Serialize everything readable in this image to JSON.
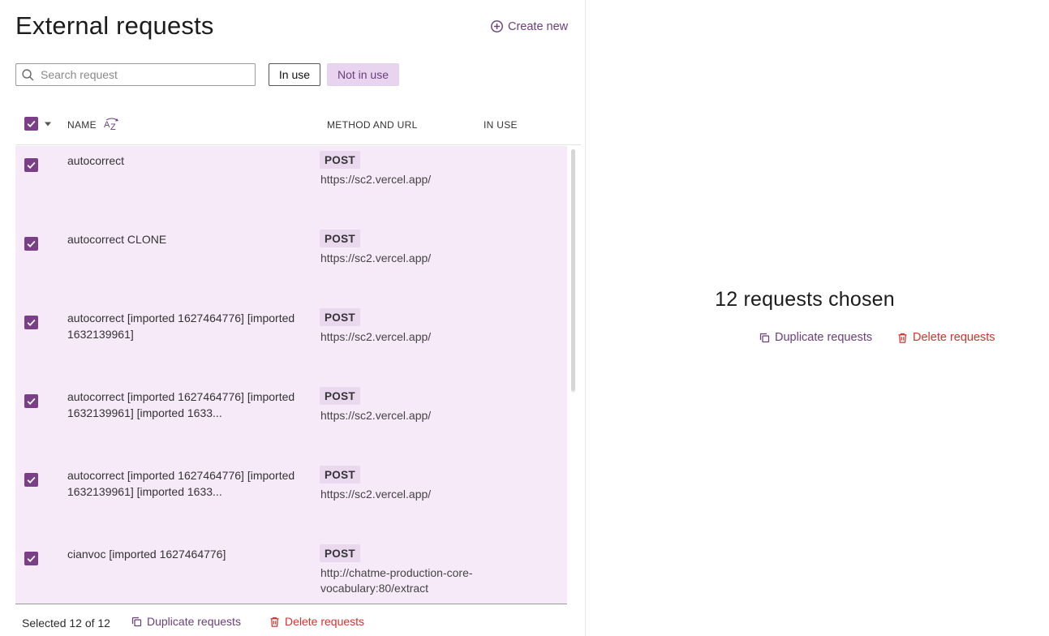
{
  "header": {
    "title": "External requests",
    "create_new_label": "Create new"
  },
  "search": {
    "placeholder": "Search request",
    "value": ""
  },
  "filters": {
    "in_use_label": "In use",
    "not_in_use_label": "Not in use",
    "active": "Not in use"
  },
  "table": {
    "columns": {
      "name": "NAME",
      "method_url": "METHOD AND URL",
      "in_use": "IN USE"
    },
    "rows": [
      {
        "name": "autocorrect",
        "method": "POST",
        "url": "https://sc2.vercel.app/",
        "checked": true
      },
      {
        "name": "autocorrect CLONE",
        "method": "POST",
        "url": "https://sc2.vercel.app/",
        "checked": true
      },
      {
        "name": "autocorrect [imported 1627464776] [imported 1632139961]",
        "method": "POST",
        "url": "https://sc2.vercel.app/",
        "checked": true
      },
      {
        "name": "autocorrect [imported 1627464776] [imported 1632139961] [imported 1633...",
        "method": "POST",
        "url": "https://sc2.vercel.app/",
        "checked": true
      },
      {
        "name": "autocorrect [imported 1627464776] [imported 1632139961] [imported 1633...",
        "method": "POST",
        "url": "https://sc2.vercel.app/",
        "checked": true
      },
      {
        "name": "cianvoc [imported 1627464776]",
        "method": "POST",
        "url": "http://chatme-production-core-vocabulary:80/extract",
        "checked": true
      }
    ]
  },
  "footer": {
    "selected_text": "Selected 12 of 12",
    "duplicate_label": "Duplicate requests",
    "delete_label": "Delete requests"
  },
  "selection_panel": {
    "title": "12 requests chosen",
    "duplicate_label": "Duplicate requests",
    "delete_label": "Delete requests"
  },
  "colors": {
    "accent": "#7b3f87",
    "accent_text": "#6b3e7a",
    "selected_row_bg": "#f6eaf8",
    "danger": "#d0342c"
  }
}
